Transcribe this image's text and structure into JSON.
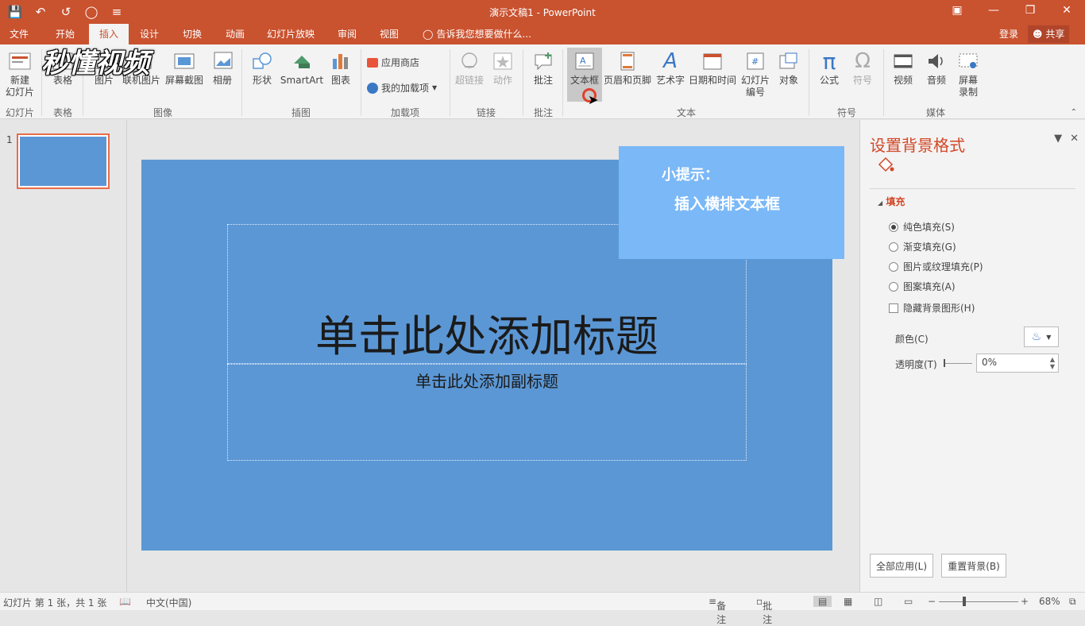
{
  "window": {
    "title": "演示文稿1 - PowerPoint"
  },
  "tabs": [
    "文件",
    "开始",
    "插入",
    "设计",
    "切换",
    "动画",
    "幻灯片放映",
    "审阅",
    "视图"
  ],
  "active_tab": "插入",
  "tell_me": "告诉我您想要做什么...",
  "account": {
    "login": "登录",
    "share": "共享"
  },
  "ribbon": {
    "new_slide": "新建\n幻灯片",
    "table": "表格",
    "picture": "图片",
    "online_picture": "联机图片",
    "screenshot": "屏幕截图",
    "album": "相册",
    "shapes": "形状",
    "smartart": "SmartArt",
    "chart": "图表",
    "store": "应用商店",
    "my_addins": "我的加载项",
    "hyperlink": "超链接",
    "action": "动作",
    "comment": "批注",
    "textbox": "文本框",
    "header_footer": "页眉和页脚",
    "wordart": "艺术字",
    "datetime": "日期和时间",
    "slide_number": "幻灯片\n编号",
    "object": "对象",
    "equation": "公式",
    "symbol": "符号",
    "video": "视频",
    "audio": "音频",
    "screen_record": "屏幕\n录制",
    "groups": {
      "slides": "幻灯片",
      "tables": "表格",
      "images": "图像",
      "illustrations": "插图",
      "addins": "加载项",
      "links": "链接",
      "comments": "批注",
      "text": "文本",
      "symbols": "符号",
      "media": "媒体"
    }
  },
  "watermark": "秒懂视频",
  "thumbnails": {
    "number": "1"
  },
  "slide": {
    "title_placeholder": "单击此处添加标题",
    "subtitle_placeholder": "单击此处添加副标题"
  },
  "tip": {
    "line1": "小提示：",
    "line2": "插入横排文本框"
  },
  "format_pane": {
    "title": "设置背景格式",
    "section": "填充",
    "options": [
      "纯色填充(S)",
      "渐变填充(G)",
      "图片或纹理填充(P)",
      "图案填充(A)"
    ],
    "selected_option": 0,
    "hide_bg": "隐藏背景图形(H)",
    "color_label": "颜色(C)",
    "transparency_label": "透明度(T)",
    "transparency_value": "0%",
    "apply_all": "全部应用(L)",
    "reset_bg": "重置背景(B)"
  },
  "status": {
    "slide_info": "幻灯片 第 1 张，共 1 张",
    "language": "中文(中国)",
    "notes": "备注",
    "comments": "批注",
    "zoom": "68%"
  }
}
